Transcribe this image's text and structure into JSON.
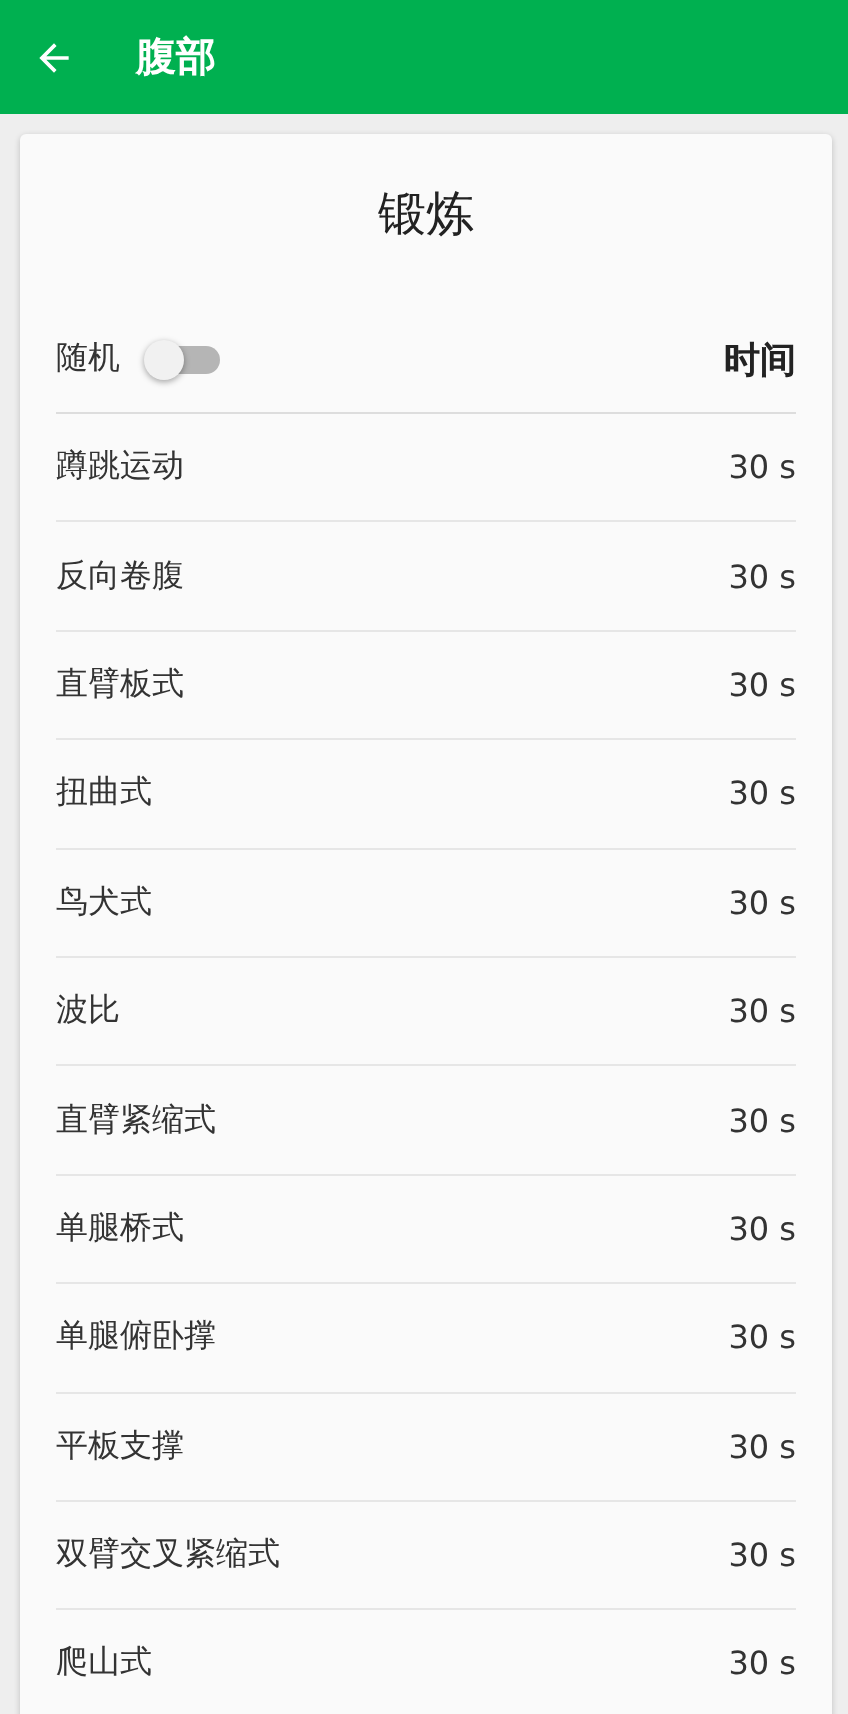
{
  "app_bar": {
    "title": "腹部"
  },
  "card": {
    "title": "锻炼",
    "random_label": "随机",
    "random_on": false,
    "time_header": "时间",
    "exercises": [
      {
        "name": "蹲跳运动",
        "duration": "30 s"
      },
      {
        "name": "反向卷腹",
        "duration": "30 s"
      },
      {
        "name": "直臂板式",
        "duration": "30 s"
      },
      {
        "name": "扭曲式",
        "duration": "30 s"
      },
      {
        "name": "鸟犬式",
        "duration": "30 s"
      },
      {
        "name": "波比",
        "duration": "30 s"
      },
      {
        "name": "直臂紧缩式",
        "duration": "30 s"
      },
      {
        "name": "单腿桥式",
        "duration": "30 s"
      },
      {
        "name": "单腿俯卧撑",
        "duration": "30 s"
      },
      {
        "name": "平板支撑",
        "duration": "30 s"
      },
      {
        "name": "双臂交叉紧缩式",
        "duration": "30 s"
      },
      {
        "name": "爬山式",
        "duration": "30 s"
      }
    ]
  }
}
